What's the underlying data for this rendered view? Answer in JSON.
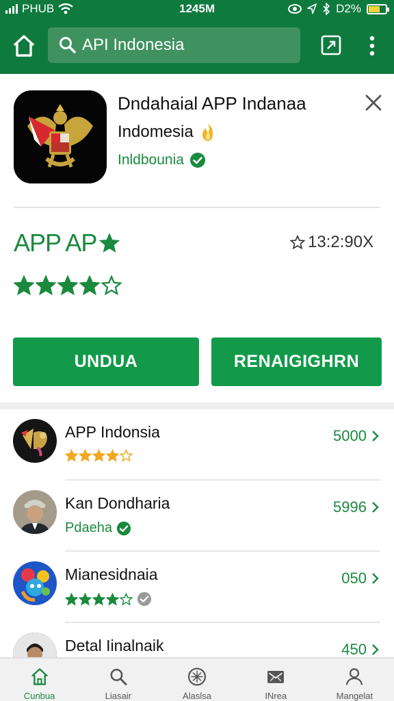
{
  "status_bar": {
    "carrier": "PHUB",
    "time": "1245M",
    "battery": "D2%"
  },
  "toolbar": {
    "search_value": "API Indonesia"
  },
  "app": {
    "title": "Dndahaial APP Indanaa",
    "subtitle": "Indomesia",
    "developer": "Inldbounia",
    "stat_label": "APP AP",
    "stat_count": "13:2:90X",
    "rating_stars": 4,
    "download_label": "UNDUA",
    "secondary_label": "RENAIGIGHRN"
  },
  "list": {
    "items": [
      {
        "title": "APP Indonsia",
        "sub": "",
        "value": "5000",
        "stars": 4.5,
        "badge": "none"
      },
      {
        "title": "Kan Dondharia",
        "sub": "Pdaeha",
        "value": "5996",
        "stars": 0,
        "badge": "verified"
      },
      {
        "title": "Mianesidnaia",
        "sub": "",
        "value": "050",
        "stars": 4,
        "badge": "gray"
      },
      {
        "title": "Detal Iinalnaik",
        "sub": "",
        "value": "450",
        "stars": 0,
        "badge": "none"
      }
    ]
  },
  "bottom_nav": {
    "items": [
      {
        "label": "Cunbua",
        "icon": "home-icon"
      },
      {
        "label": "Liasair",
        "icon": "search-icon"
      },
      {
        "label": "Alaslsa",
        "icon": "compass-icon"
      },
      {
        "label": "INrea",
        "icon": "mail-icon"
      },
      {
        "label": "Mangelat",
        "icon": "profile-icon"
      }
    ]
  },
  "colors": {
    "brand_green": "#0f7a3d",
    "button_green": "#129a4a",
    "accent_green": "#1a8a3e",
    "star_gold": "#f2a71e"
  }
}
